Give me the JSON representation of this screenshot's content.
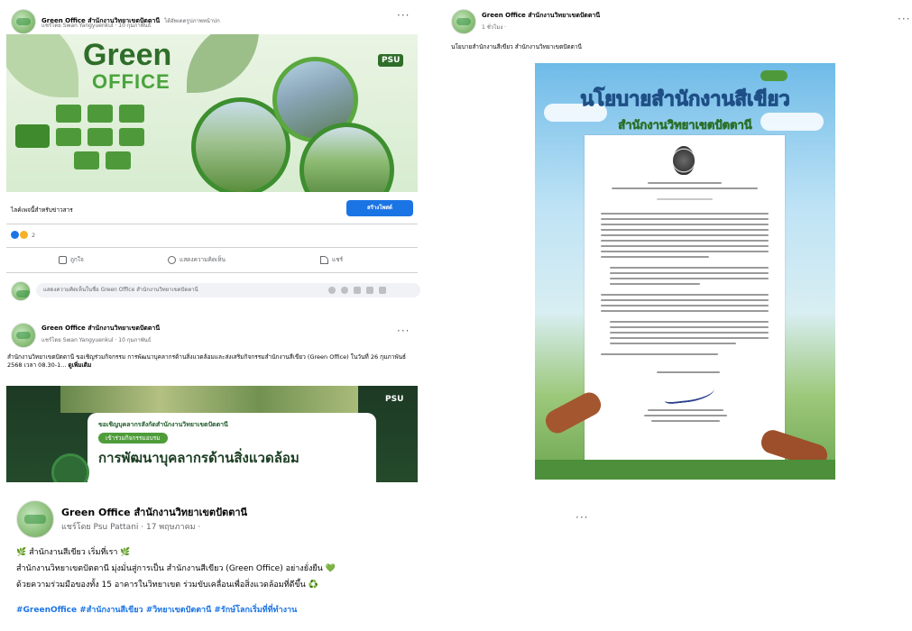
{
  "post1": {
    "page_name": "Green Office สำนักงานวิทยาเขตปัตตานี",
    "title_suffix": "ได้อัพเดตรูปภาพหน้าปก",
    "meta": "แชร์โดย Swan Yangyuenkul · 10 กุมภาพันธ์",
    "banner": {
      "title": "Green",
      "subtitle": "OFFICE",
      "logo": "PSU"
    },
    "cta_text": "ไลค์เพจนี้สำหรับข่าวสาร",
    "cta_button": "สร้างโพสต์",
    "reaction_count": "2",
    "actions": {
      "like": "ถูกใจ",
      "comment": "แสดงความคิดเห็น",
      "share": "แชร์"
    },
    "comment_placeholder": "แสดงความคิดเห็นในชื่อ Green Office สำนักงานวิทยาเขตปัตตานี"
  },
  "post2": {
    "page_name": "Green Office สำนักงานวิทยาเขตปัตตานี",
    "meta": "แชร์โดย Swan Yangyuenkul · 10 กุมภาพันธ์",
    "text": "สำนักงานวิทยาเขตปัตตานี ขอเชิญร่วมกิจกรรม การพัฒนาบุคลากรด้านสิ่งแวดล้อมและส่งเสริมกิจกรรมสำนักงานสีเขียว (Green Office) ในวันที่ 26 กุมภาพันธ์ 2568 เวลา 08.30-1...",
    "see_more": "ดูเพิ่มเติม",
    "image_heading": "ขอเชิญบุคลากรสังกัดสำนักงานวิทยาเขตปัตตานี",
    "image_tag": "เข้าร่วมกิจกรรมอบรม",
    "image_title": "การพัฒนาบุคลากรด้านสิ่งแวดล้อม",
    "image_logo": "PSU"
  },
  "post3": {
    "page_name": "Green Office สำนักงานวิทยาเขตปัตตานี",
    "meta": "1 ชั่วโมง ·",
    "text": "นโยบายสำนักงานสีเขียว สำนักงานวิทยาเขตปัตตานี",
    "poster_title": "นโยบายสำนักงานสีเขียว",
    "poster_subtitle": "สำนักงานวิทยาเขตปัตตานี"
  },
  "post4": {
    "page_name": "Green Office สำนักงานวิทยาเขตปัตตานี",
    "meta": "แชร์โดย Psu Pattani · 17 พฤษภาคม ·",
    "line1": "🌿 สำนักงานสีเขียว เริ่มที่เรา 🌿",
    "line2": "สำนักงานวิทยาเขตปัตตานี มุ่งมั่นสู่การเป็น สำนักงานสีเขียว (Green Office) อย่างยั่งยืน 💚",
    "line3": "ด้วยความร่วมมือของทั้ง 15 อาคารในวิทยาเขต ร่วมขับเคลื่อนเพื่อสิ่งแวดล้อมที่ดีขึ้น ♻️",
    "hashtags": "#GreenOffice #สำนักงานสีเขียว #วิทยาเขตปัตตานี #รักษ์โลกเริ่มที่ที่ทำงาน"
  },
  "more_label": "···",
  "colors": {
    "fb_blue": "#1b74e4",
    "text": "#050505",
    "muted": "#65676b",
    "green": "#3b8d2e",
    "sky": "#5ab0e6"
  }
}
